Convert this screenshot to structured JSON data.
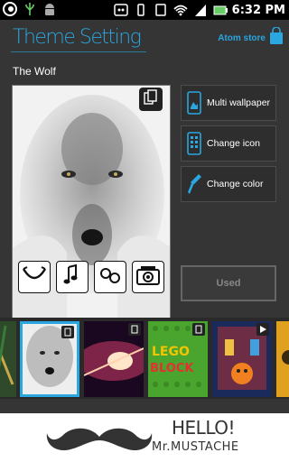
{
  "status_bar": {
    "time": "6:32 PM"
  },
  "header": {
    "title": "Theme Setting",
    "store_label": "Atom store"
  },
  "theme": {
    "name": "The Wolf"
  },
  "actions": [
    {
      "label": "Multi wallpaper",
      "icon": "phone-wallpaper-icon"
    },
    {
      "label": "Change icon",
      "icon": "phone-grid-icon"
    },
    {
      "label": "Change color",
      "icon": "eyedropper-icon"
    }
  ],
  "used_button": {
    "label": "Used"
  },
  "thumbnails": [
    {
      "name": "partial-left",
      "colors": [
        "#c8a84a",
        "#3a7a3a"
      ]
    },
    {
      "name": "wolf",
      "selected": true
    },
    {
      "name": "space-flare"
    },
    {
      "name": "lego-block",
      "text1": "LEGO",
      "text2": "BLOCK"
    },
    {
      "name": "halloween"
    },
    {
      "name": "partial-right"
    }
  ],
  "ad": {
    "line1": "HELLO!",
    "line2": "Mr.MUSTACHE"
  },
  "colors": {
    "accent": "#2aa6e0",
    "background": "#353535"
  }
}
